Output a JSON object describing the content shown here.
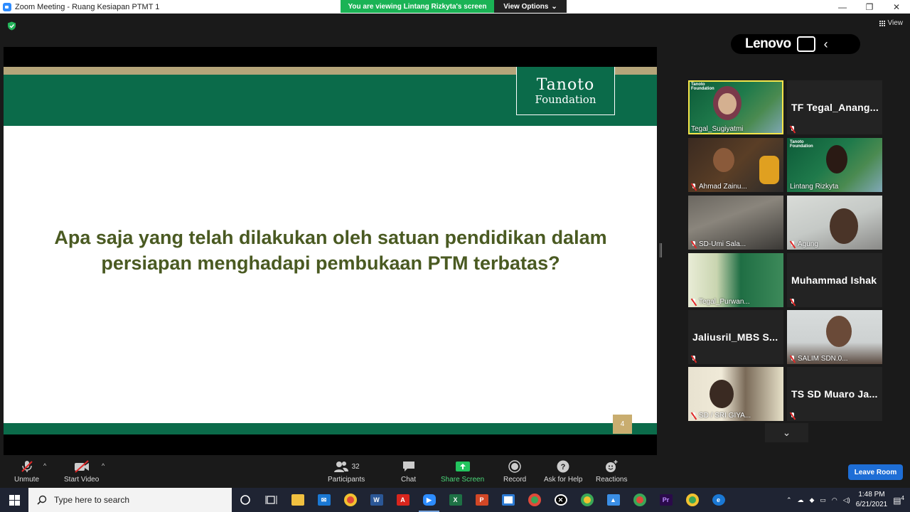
{
  "window": {
    "title": "Zoom Meeting - Ruang Kesiapan PTMT 1",
    "viewing_banner": "You are viewing Lintang Rizkyta's screen",
    "view_options": "View Options"
  },
  "top_right": {
    "view_label": "View"
  },
  "badge": {
    "brand": "Lenovo"
  },
  "slide": {
    "logo_line1": "Tanoto",
    "logo_line2": "Foundation",
    "question_line1": "Apa saja yang telah dilakukan oleh satuan pendidikan dalam",
    "question_line2": "persiapan menghadapi pembukaan PTM terbatas?",
    "page_number": "4"
  },
  "participants_gallery": [
    {
      "name": "Tegal_Sugiyatmi",
      "video": true,
      "active": true
    },
    {
      "name": "TF  Tegal_Anang...",
      "video": false
    },
    {
      "name": "Ahmad Zainu...",
      "video": true
    },
    {
      "name": "Lintang Rizkyta",
      "video": true
    },
    {
      "name": "SD-Umi Sala...",
      "video": true
    },
    {
      "name": "Agung",
      "video": true
    },
    {
      "name": "Tegal_Purwan...",
      "video": true
    },
    {
      "name": "Muhammad Ishak",
      "video": false
    },
    {
      "name": "Jaliusril_MBS  S...",
      "video": false
    },
    {
      "name": "SALIM SDN.0...",
      "video": true
    },
    {
      "name": "SD / SRI GIYA...",
      "video": true
    },
    {
      "name": "TS SD Muaro Ja...",
      "video": false
    }
  ],
  "toolbar": {
    "unmute": "Unmute",
    "start_video": "Start Video",
    "participants": "Participants",
    "participants_count": "32",
    "chat": "Chat",
    "share_screen": "Share Screen",
    "record": "Record",
    "ask_for_help": "Ask for Help",
    "reactions": "Reactions",
    "leave_room": "Leave Room"
  },
  "taskbar": {
    "search_placeholder": "Type here to search",
    "time": "1:48 PM",
    "date": "6/21/2021",
    "notifications": "4"
  },
  "colors": {
    "share_green": "#1ab355",
    "slide_green": "#0b6b4a",
    "slide_gold": "#b5a57a",
    "question_text": "#4a5a22",
    "leave_blue": "#1e6ed6",
    "active_speaker": "#f5e64a"
  }
}
